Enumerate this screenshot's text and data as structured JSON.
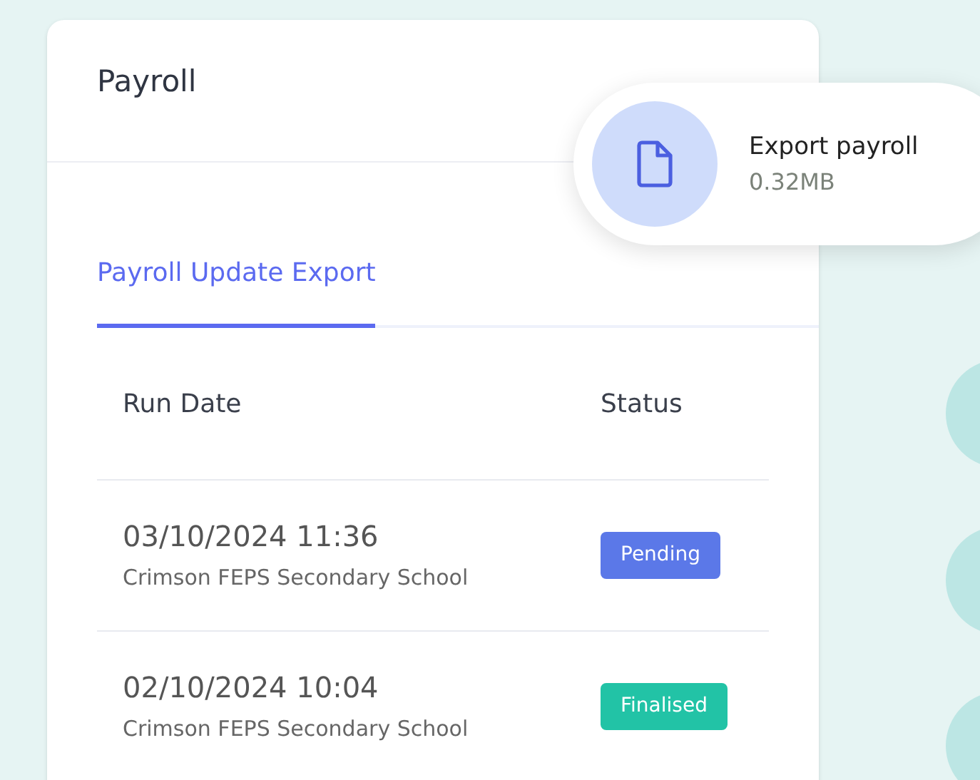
{
  "card": {
    "title": "Payroll"
  },
  "tabs": [
    {
      "label": "Payroll Update Export",
      "selected": true
    }
  ],
  "table": {
    "columns": [
      "Run Date",
      "Status"
    ],
    "rows": [
      {
        "date": "03/10/2024 11:36",
        "school": "Crimson FEPS Secondary School",
        "status": {
          "label": "Pending",
          "kind": "pending"
        }
      },
      {
        "date": "02/10/2024 10:04",
        "school": "Crimson FEPS Secondary School",
        "status": {
          "label": "Finalised",
          "kind": "finalised"
        }
      }
    ]
  },
  "export_popup": {
    "title": "Export payroll",
    "size": "0.32MB"
  }
}
